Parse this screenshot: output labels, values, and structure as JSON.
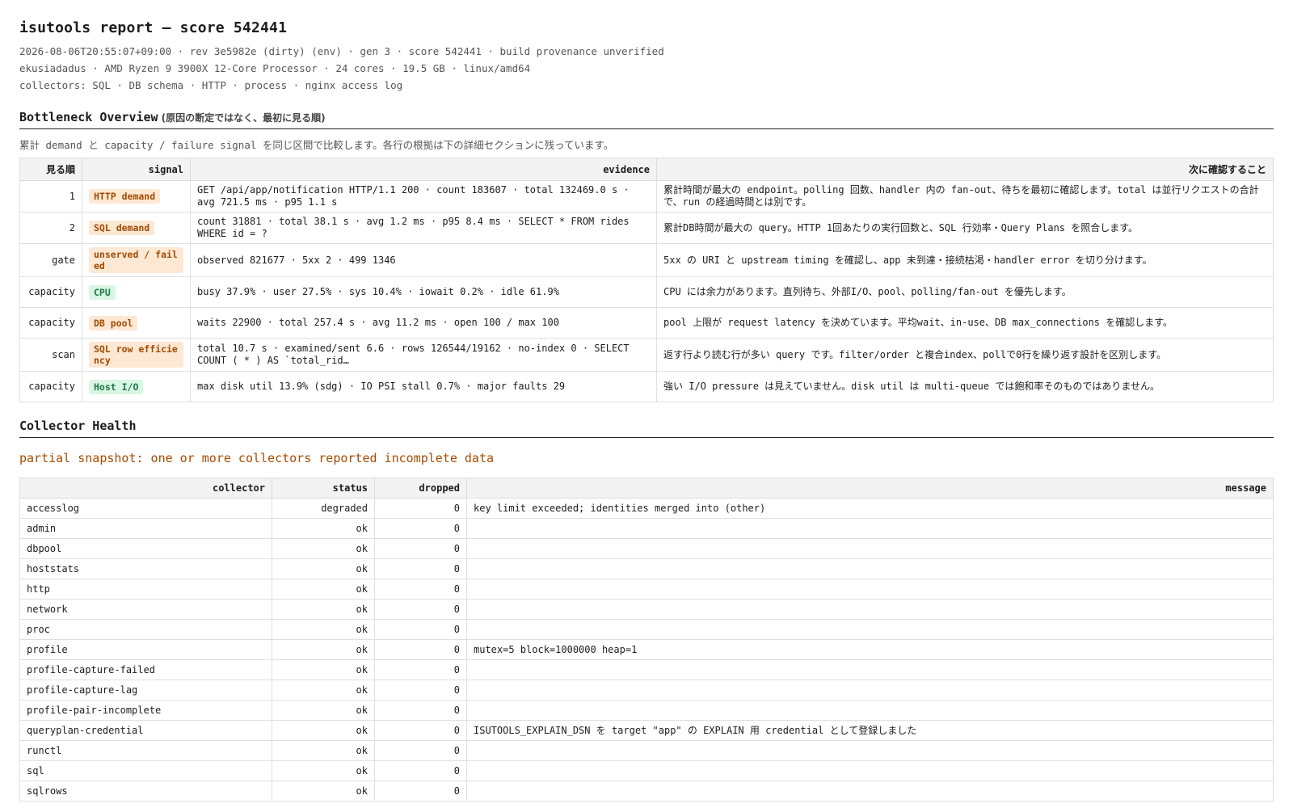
{
  "report": {
    "title": "isutools report — score 542441",
    "meta_lines": [
      "2026-08-06T20:55:07+09:00 · rev 3e5982e (dirty) (env) · gen 3 · score 542441 · build provenance unverified",
      "ekusiadadus · AMD Ryzen 9 3900X 12-Core Processor · 24 cores · 19.5 GB · linux/amd64",
      "collectors: SQL · DB schema · HTTP · process · nginx access log"
    ]
  },
  "overview": {
    "heading": "Bottleneck Overview",
    "heading_note": "(原因の断定ではなく、最初に見る順)",
    "lede": "累計 demand と capacity / failure signal を同じ区間で比較します。各行の根拠は下の詳細セクションに残っています。",
    "columns": [
      "見る順",
      "signal",
      "evidence",
      "次に確認すること"
    ],
    "rows": [
      {
        "order": "1",
        "signal": "HTTP demand",
        "tone": "warn",
        "evidence": "GET /api/app/notification HTTP/1.1 200 · count 183607 · total 132469.0 s · avg 721.5 ms · p95 1.1 s",
        "next": "累計時間が最大の endpoint。polling 回数、handler 内の fan-out、待ちを最初に確認します。total は並行リクエストの合計で、run の経過時間とは別です。"
      },
      {
        "order": "2",
        "signal": "SQL demand",
        "tone": "warn",
        "evidence": "count 31881 · total 38.1 s · avg 1.2 ms · p95 8.4 ms · SELECT * FROM rides WHERE id = ?",
        "next": "累計DB時間が最大の query。HTTP 1回あたりの実行回数と、SQL 行効率・Query Plans を照合します。"
      },
      {
        "order": "gate",
        "signal": "unserved / failed",
        "tone": "warn",
        "evidence": "observed 821677 · 5xx 2 · 499 1346",
        "next": "5xx の URI と upstream timing を確認し、app 未到達・接続枯渇・handler error を切り分けます。"
      },
      {
        "order": "capacity",
        "signal": "CPU",
        "tone": "ok",
        "evidence": "busy 37.9% · user 27.5% · sys 10.4% · iowait 0.2% · idle 61.9%",
        "next": "CPU には余力があります。直列待ち、外部I/O、pool、polling/fan-out を優先します。"
      },
      {
        "order": "capacity",
        "signal": "DB pool",
        "tone": "warn",
        "evidence": "waits 22900 · total 257.4 s · avg 11.2 ms · open 100 / max 100",
        "next": "pool 上限が request latency を決めています。平均wait、in-use、DB max_connections を確認します。"
      },
      {
        "order": "scan",
        "signal": "SQL row efficiency",
        "tone": "warn",
        "evidence": "total 10.7 s · examined/sent 6.6 · rows 126544/19162 · no-index 0 · SELECT COUNT ( * ) AS `total_rid…",
        "next": "返す行より読む行が多い query です。filter/order と複合index、pollで0行を繰り返す設計を区別します。"
      },
      {
        "order": "capacity",
        "signal": "Host I/O",
        "tone": "ok",
        "evidence": "max disk util 13.9% (sdg) · IO PSI stall 0.7% · major faults 29",
        "next": "強い I/O pressure は見えていません。disk util は multi-queue では飽和率そのものではありません。"
      }
    ]
  },
  "health": {
    "heading": "Collector Health",
    "warning": "partial snapshot: one or more collectors reported incomplete data",
    "columns": [
      "collector",
      "status",
      "dropped",
      "message"
    ],
    "rows": [
      {
        "collector": "accesslog",
        "status": "degraded",
        "dropped": "0",
        "message": "key limit exceeded; identities merged into (other)"
      },
      {
        "collector": "admin",
        "status": "ok",
        "dropped": "0",
        "message": ""
      },
      {
        "collector": "dbpool",
        "status": "ok",
        "dropped": "0",
        "message": ""
      },
      {
        "collector": "hoststats",
        "status": "ok",
        "dropped": "0",
        "message": ""
      },
      {
        "collector": "http",
        "status": "ok",
        "dropped": "0",
        "message": ""
      },
      {
        "collector": "network",
        "status": "ok",
        "dropped": "0",
        "message": ""
      },
      {
        "collector": "proc",
        "status": "ok",
        "dropped": "0",
        "message": ""
      },
      {
        "collector": "profile",
        "status": "ok",
        "dropped": "0",
        "message": "mutex=5 block=1000000 heap=1"
      },
      {
        "collector": "profile-capture-failed",
        "status": "ok",
        "dropped": "0",
        "message": ""
      },
      {
        "collector": "profile-capture-lag",
        "status": "ok",
        "dropped": "0",
        "message": ""
      },
      {
        "collector": "profile-pair-incomplete",
        "status": "ok",
        "dropped": "0",
        "message": ""
      },
      {
        "collector": "queryplan-credential",
        "status": "ok",
        "dropped": "0",
        "message": "ISUTOOLS_EXPLAIN_DSN を target \"app\" の EXPLAIN 用 credential として登録しました"
      },
      {
        "collector": "runctl",
        "status": "ok",
        "dropped": "0",
        "message": ""
      },
      {
        "collector": "sql",
        "status": "ok",
        "dropped": "0",
        "message": ""
      },
      {
        "collector": "sqlrows",
        "status": "ok",
        "dropped": "0",
        "message": ""
      }
    ]
  }
}
